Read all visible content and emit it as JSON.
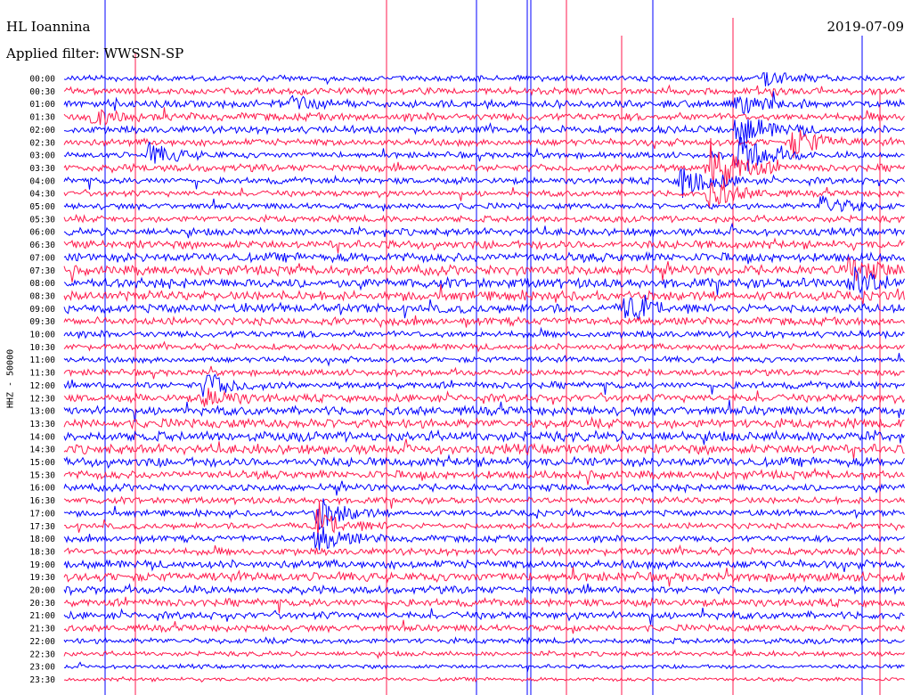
{
  "header": {
    "station": "HL Ioannina",
    "filter": "Applied filter: WWSSN-SP",
    "date": "2019-07-09"
  },
  "chart_data": {
    "type": "helicorder",
    "ylabel": "HHZ - 50000",
    "row_labels": [
      "00:00",
      "00:30",
      "01:00",
      "01:30",
      "02:00",
      "02:30",
      "03:00",
      "03:30",
      "04:00",
      "04:30",
      "05:00",
      "05:30",
      "06:00",
      "06:30",
      "07:00",
      "07:30",
      "08:00",
      "08:30",
      "09:00",
      "09:30",
      "10:00",
      "10:30",
      "11:00",
      "11:30",
      "12:00",
      "12:30",
      "13:00",
      "13:30",
      "14:00",
      "14:30",
      "15:00",
      "15:30",
      "16:00",
      "16:30",
      "17:00",
      "17:30",
      "18:00",
      "18:30",
      "19:00",
      "19:30",
      "20:00",
      "20:30",
      "21:00",
      "21:30",
      "22:00",
      "22:30",
      "23:00",
      "23:30"
    ],
    "series_colors": [
      "#0000ff",
      "#ff1a4d"
    ],
    "events": [
      {
        "row": 2,
        "minute": 8,
        "amp": 2.5
      },
      {
        "row": 2,
        "minute": 24,
        "amp": 2.8
      },
      {
        "row": 4,
        "minute": 24,
        "amp": 4.5
      },
      {
        "row": 5,
        "minute": 26,
        "amp": 4.0
      },
      {
        "row": 6,
        "minute": 24,
        "amp": 6.0
      },
      {
        "row": 6,
        "minute": 3,
        "amp": 3.0
      },
      {
        "row": 7,
        "minute": 23,
        "amp": 9.0
      },
      {
        "row": 8,
        "minute": 22,
        "amp": 5.0
      },
      {
        "row": 9,
        "minute": 23,
        "amp": 4.0
      },
      {
        "row": 10,
        "minute": 27,
        "amp": 3.0
      },
      {
        "row": 16,
        "minute": 28,
        "amp": 4.5
      },
      {
        "row": 15,
        "minute": 28,
        "amp": 3.5
      },
      {
        "row": 18,
        "minute": 20,
        "amp": 3.0
      },
      {
        "row": 24,
        "minute": 5,
        "amp": 3.5
      },
      {
        "row": 25,
        "minute": 5,
        "amp": 2.5
      },
      {
        "row": 34,
        "minute": 9,
        "amp": 4.5
      },
      {
        "row": 35,
        "minute": 9,
        "amp": 4.0
      },
      {
        "row": 36,
        "minute": 9,
        "amp": 3.5
      },
      {
        "row": 0,
        "minute": 25,
        "amp": 2.0
      },
      {
        "row": 3,
        "minute": 1,
        "amp": 2.0
      }
    ]
  }
}
